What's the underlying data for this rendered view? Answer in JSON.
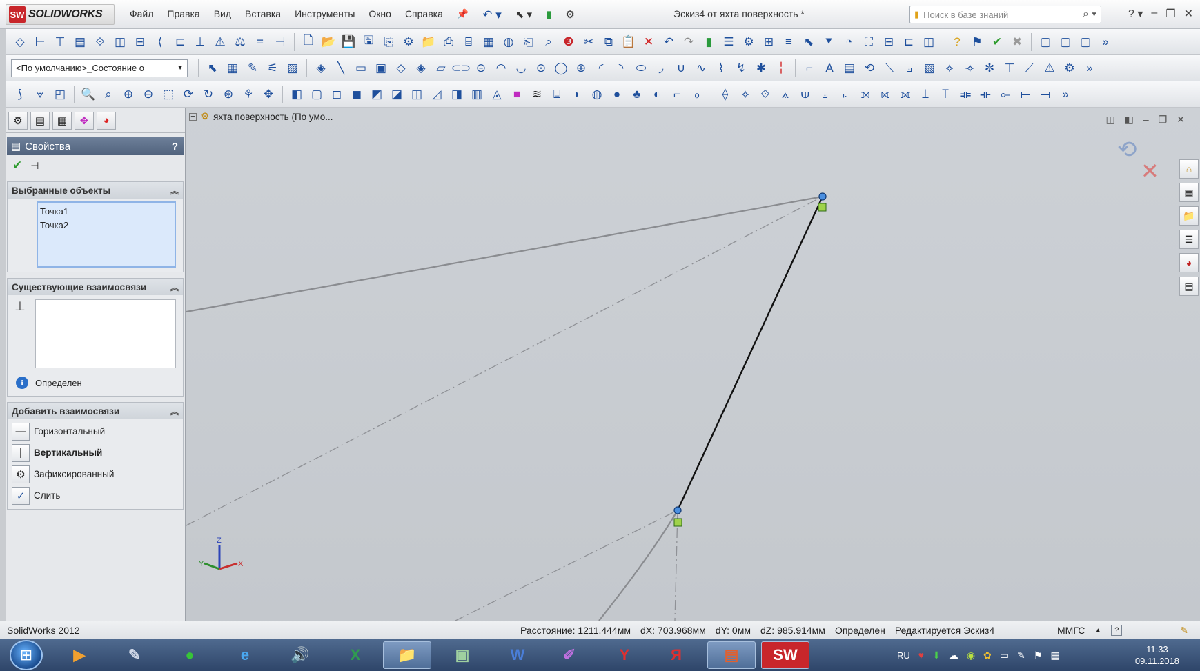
{
  "app": {
    "logo_text": "SOLIDWORKS",
    "logo_badge": "SW",
    "menu": [
      "Файл",
      "Правка",
      "Вид",
      "Вставка",
      "Инструменты",
      "Окно",
      "Справка"
    ],
    "document_title": "Эскиз4 от яхта поверхность *",
    "search_placeholder": "Поиск в базе знаний"
  },
  "toolbar": {
    "config_value": "<По умолчанию>_Состояние о"
  },
  "property_manager": {
    "title": "Свойства",
    "help": "?",
    "selected_objects": {
      "title": "Выбранные объекты",
      "items": [
        "Точка1",
        "Точка2"
      ]
    },
    "existing_relations": {
      "title": "Существующие взаимосвязи",
      "status": "Определен"
    },
    "add_relations": {
      "title": "Добавить взаимосвязи",
      "items": [
        {
          "label": "Горизонтальный",
          "icon": "horizontal-relation-icon"
        },
        {
          "label": "Вертикальный",
          "icon": "vertical-relation-icon"
        },
        {
          "label": "Зафиксированный",
          "icon": "fix-relation-icon"
        },
        {
          "label": "Слить",
          "icon": "merge-relation-icon"
        }
      ]
    }
  },
  "viewport": {
    "breadcrumb": "яхта поверхность  (По умо..."
  },
  "status_bar": {
    "app_version": "SolidWorks 2012",
    "distance": "Расстояние: 1211.444мм",
    "dx": "dX: 703.968мм",
    "dy": "dY: 0мм",
    "dz": "dZ: 985.914мм",
    "state": "Определен",
    "editing": "Редактируется Эскиз4",
    "units": "ММГС"
  },
  "taskbar": {
    "language": "RU",
    "time": "11:33",
    "date": "09.11.2018"
  },
  "colors": {
    "sketch_line": "#111111",
    "construction_line": "#8a8c90",
    "point": "#4a8fe0",
    "pm_header": "#5b6d87"
  }
}
